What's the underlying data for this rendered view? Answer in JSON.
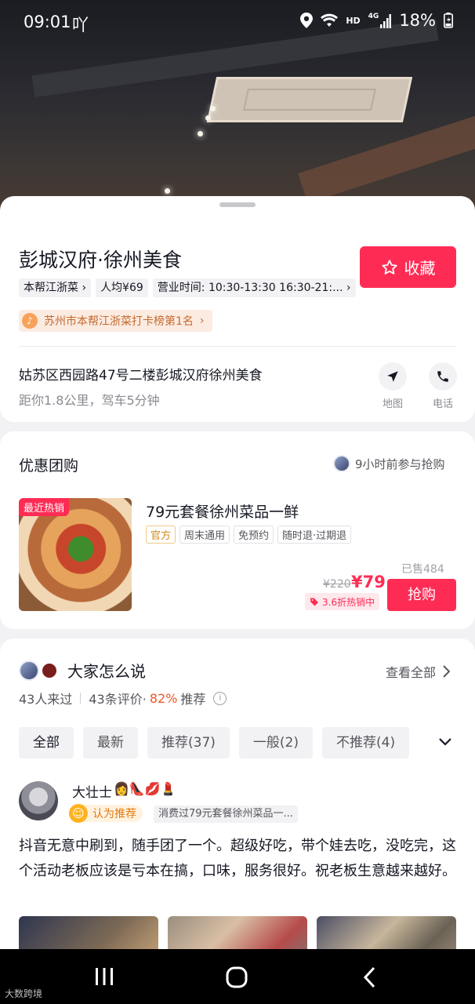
{
  "status_bar": {
    "time": "09:01",
    "carrier": "吖",
    "hd": "HD",
    "network": "4G",
    "battery": "18%"
  },
  "store": {
    "name": "彭城汉府·徐州美食",
    "favorite_label": "收藏",
    "tags": [
      "本帮江浙菜",
      "人均¥69",
      "营业时间: 10:30-13:30 16:30-21:..."
    ],
    "rank": "苏州市本帮江浙菜打卡榜第1名",
    "address": "姑苏区西园路47号二楼彭城汉府徐州美食",
    "distance": "距你1.8公里，驾车5分钟",
    "actions": {
      "map": "地图",
      "phone": "电话"
    }
  },
  "coupon": {
    "section_title": "优惠团购",
    "participation": "9小时前参与抢购",
    "badge": "最近热销",
    "title": "79元套餐徐州菜品一鲜",
    "chips": [
      "官方",
      "周末通用",
      "免预约",
      "随时退·过期退"
    ],
    "sold": "已售484",
    "old_price": "¥220",
    "price": "¥79",
    "discount": "3.6折热销中",
    "buy_label": "抢购"
  },
  "reviews": {
    "title": "大家怎么说",
    "view_all": "查看全部",
    "visited": "43人来过",
    "review_count": "43条评价·",
    "recommend_pct": "82%",
    "recommend_suffix": "推荐",
    "filters": [
      "全部",
      "最新",
      "推荐(37)",
      "一般(2)",
      "不推荐(4)"
    ],
    "first": {
      "user": "大壮士",
      "emojis": "👩👠💋💄",
      "recommend_label": "认为推荐",
      "consumed": "消费过79元套餐徐州菜品一...",
      "text": "抖音无意中刷到，随手团了一个。超级好吃，带个娃去吃，没吃完，这个活动老板应该是亏本在搞，口味，服务很好。祝老板生意越来越好。"
    }
  },
  "watermark": "大数跨境",
  "colors": {
    "accent": "#fe2c55",
    "orange": "#f0572a",
    "gold": "#d08b1c"
  }
}
